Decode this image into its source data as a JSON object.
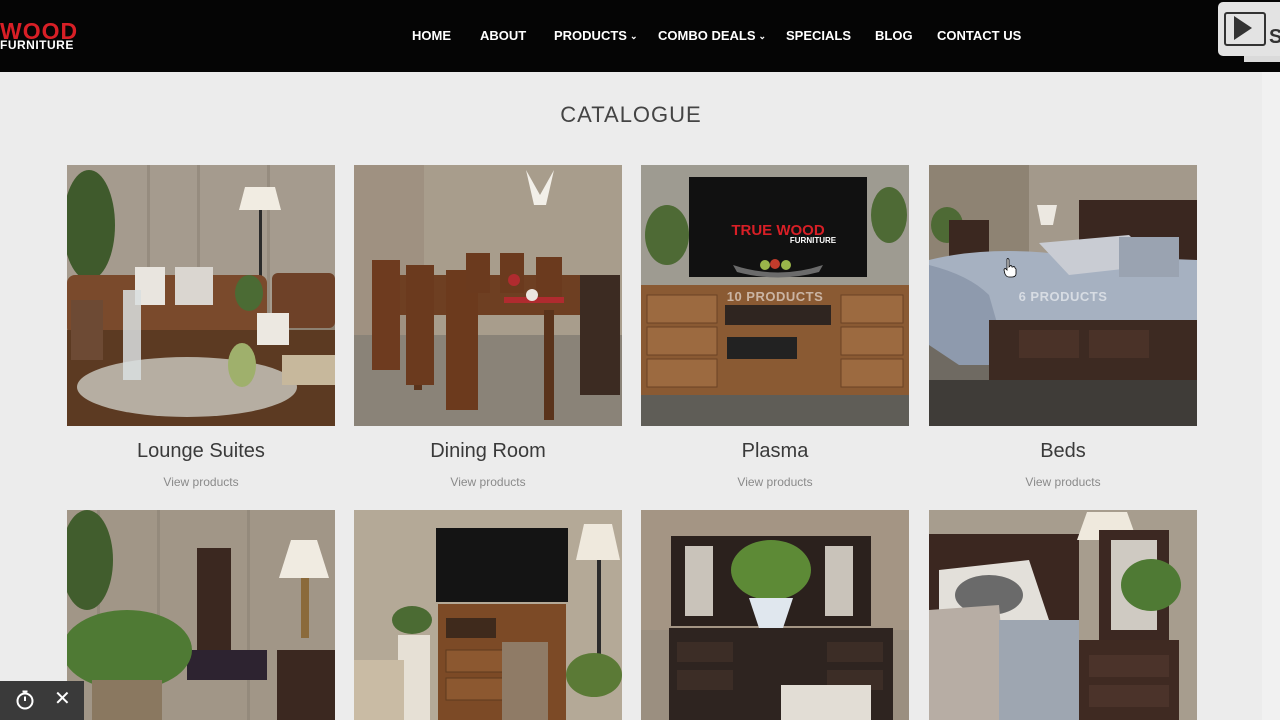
{
  "header": {
    "logo_line1": "WOOD",
    "logo_line2": "FURNITURE",
    "nav": [
      {
        "label": "HOME",
        "dropdown": false
      },
      {
        "label": "ABOUT",
        "dropdown": false
      },
      {
        "label": "PRODUCTS",
        "dropdown": true
      },
      {
        "label": "COMBO DEALS",
        "dropdown": true
      },
      {
        "label": "SPECIALS",
        "dropdown": false
      },
      {
        "label": "BLOG",
        "dropdown": false
      },
      {
        "label": "CONTACT US",
        "dropdown": false
      }
    ],
    "badge_letter": "S"
  },
  "page": {
    "title": "CATALOGUE"
  },
  "catalogue": [
    {
      "name": "Lounge Suites",
      "link": "View products",
      "count": ""
    },
    {
      "name": "Dining Room",
      "link": "View products",
      "count": ""
    },
    {
      "name": "Plasma",
      "link": "View products",
      "count": "10 PRODUCTS",
      "tv_brand": "TRUE WOOD",
      "tv_sub": "FURNITURE"
    },
    {
      "name": "Beds",
      "link": "View products",
      "count": "6 PRODUCTS"
    },
    {
      "name": "",
      "link": "",
      "count": ""
    },
    {
      "name": "",
      "link": "",
      "count": ""
    },
    {
      "name": "",
      "link": "",
      "count": ""
    },
    {
      "name": "",
      "link": "",
      "count": ""
    }
  ],
  "widget": {
    "timer_icon": "stopwatch-icon",
    "close_icon": "close-icon",
    "close_symbol": "✕"
  },
  "colors": {
    "header_bg": "#050505",
    "brand_red": "#d81f26",
    "page_bg": "#ececec"
  }
}
